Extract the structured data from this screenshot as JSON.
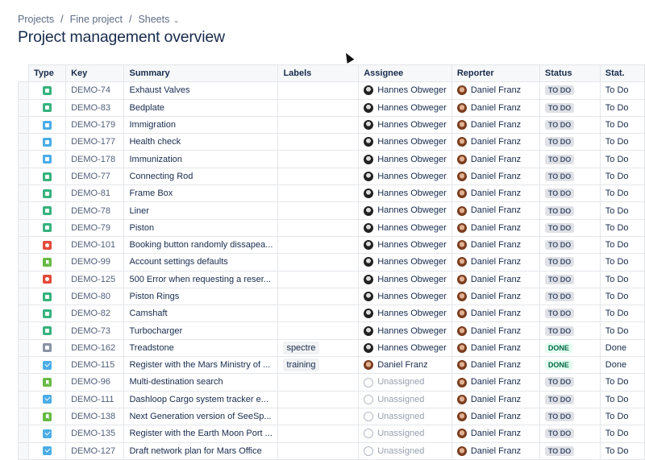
{
  "breadcrumbs": [
    "Projects",
    "Fine project",
    "Sheets"
  ],
  "title": "Project management overview",
  "columns": [
    "Type",
    "Key",
    "Summary",
    "Labels",
    "Assignee",
    "Reporter",
    "Status",
    "Stat."
  ],
  "type_colors": {
    "subtask": "#36b37e",
    "subtask-blue": "#4bade8",
    "bug": "#e5493a",
    "story": "#65ba43",
    "task": "#4bade8",
    "other": "#8993a4"
  },
  "rows": [
    {
      "type": "subtask",
      "key": "DEMO-74",
      "summary": "Exhaust Valves",
      "label": "",
      "assignee": "Hannes Obweger",
      "reporter": "Daniel Franz",
      "status": "TO DO",
      "status2": "To Do"
    },
    {
      "type": "subtask",
      "key": "DEMO-83",
      "summary": "Bedplate",
      "label": "",
      "assignee": "Hannes Obweger",
      "reporter": "Daniel Franz",
      "status": "TO DO",
      "status2": "To Do"
    },
    {
      "type": "subtask-blue",
      "key": "DEMO-179",
      "summary": "Immigration",
      "label": "",
      "assignee": "Hannes Obweger",
      "reporter": "Daniel Franz",
      "status": "TO DO",
      "status2": "To Do"
    },
    {
      "type": "subtask-blue",
      "key": "DEMO-177",
      "summary": "Health check",
      "label": "",
      "assignee": "Hannes Obweger",
      "reporter": "Daniel Franz",
      "status": "TO DO",
      "status2": "To Do"
    },
    {
      "type": "subtask-blue",
      "key": "DEMO-178",
      "summary": "Immunization",
      "label": "",
      "assignee": "Hannes Obweger",
      "reporter": "Daniel Franz",
      "status": "TO DO",
      "status2": "To Do"
    },
    {
      "type": "subtask",
      "key": "DEMO-77",
      "summary": "Connecting Rod",
      "label": "",
      "assignee": "Hannes Obweger",
      "reporter": "Daniel Franz",
      "status": "TO DO",
      "status2": "To Do"
    },
    {
      "type": "subtask",
      "key": "DEMO-81",
      "summary": "Frame Box",
      "label": "",
      "assignee": "Hannes Obweger",
      "reporter": "Daniel Franz",
      "status": "TO DO",
      "status2": "To Do"
    },
    {
      "type": "subtask",
      "key": "DEMO-78",
      "summary": "Liner",
      "label": "",
      "assignee": "Hannes Obweger",
      "reporter": "Daniel Franz",
      "status": "TO DO",
      "status2": "To Do"
    },
    {
      "type": "subtask",
      "key": "DEMO-79",
      "summary": "Piston",
      "label": "",
      "assignee": "Hannes Obweger",
      "reporter": "Daniel Franz",
      "status": "TO DO",
      "status2": "To Do"
    },
    {
      "type": "bug",
      "key": "DEMO-101",
      "summary": "Booking button randomly dissapea...",
      "label": "",
      "assignee": "Hannes Obweger",
      "reporter": "Daniel Franz",
      "status": "TO DO",
      "status2": "To Do"
    },
    {
      "type": "story",
      "key": "DEMO-99",
      "summary": "Account settings defaults",
      "label": "",
      "assignee": "Hannes Obweger",
      "reporter": "Daniel Franz",
      "status": "TO DO",
      "status2": "To Do"
    },
    {
      "type": "bug",
      "key": "DEMO-125",
      "summary": "500 Error when requesting a reser...",
      "label": "",
      "assignee": "Hannes Obweger",
      "reporter": "Daniel Franz",
      "status": "TO DO",
      "status2": "To Do"
    },
    {
      "type": "subtask",
      "key": "DEMO-80",
      "summary": "Piston Rings",
      "label": "",
      "assignee": "Hannes Obweger",
      "reporter": "Daniel Franz",
      "status": "TO DO",
      "status2": "To Do"
    },
    {
      "type": "subtask",
      "key": "DEMO-82",
      "summary": "Camshaft",
      "label": "",
      "assignee": "Hannes Obweger",
      "reporter": "Daniel Franz",
      "status": "TO DO",
      "status2": "To Do"
    },
    {
      "type": "subtask",
      "key": "DEMO-73",
      "summary": "Turbocharger",
      "label": "",
      "assignee": "Hannes Obweger",
      "reporter": "Daniel Franz",
      "status": "TO DO",
      "status2": "To Do"
    },
    {
      "type": "other",
      "key": "DEMO-162",
      "summary": "Treadstone",
      "label": "spectre",
      "assignee": "Hannes Obweger",
      "reporter": "Daniel Franz",
      "status": "DONE",
      "status2": "Done"
    },
    {
      "type": "task",
      "key": "DEMO-115",
      "summary": "Register with the Mars Ministry of ...",
      "label": "training",
      "assignee": "Daniel Franz",
      "reporter": "Daniel Franz",
      "status": "DONE",
      "status2": "Done"
    },
    {
      "type": "story",
      "key": "DEMO-96",
      "summary": "Multi-destination search",
      "label": "",
      "assignee": "Unassigned",
      "reporter": "Daniel Franz",
      "status": "TO DO",
      "status2": "To Do"
    },
    {
      "type": "task",
      "key": "DEMO-111",
      "summary": "Dashloop Cargo system tracker e...",
      "label": "",
      "assignee": "Unassigned",
      "reporter": "Daniel Franz",
      "status": "TO DO",
      "status2": "To Do"
    },
    {
      "type": "story",
      "key": "DEMO-138",
      "summary": "Next Generation version of SeeSp...",
      "label": "",
      "assignee": "Unassigned",
      "reporter": "Daniel Franz",
      "status": "TO DO",
      "status2": "To Do"
    },
    {
      "type": "task",
      "key": "DEMO-135",
      "summary": "Register with the Earth Moon Port ...",
      "label": "",
      "assignee": "Unassigned",
      "reporter": "Daniel Franz",
      "status": "TO DO",
      "status2": "To Do"
    },
    {
      "type": "task",
      "key": "DEMO-127",
      "summary": "Draft network plan for Mars Office",
      "label": "",
      "assignee": "Unassigned",
      "reporter": "Daniel Franz",
      "status": "TO DO",
      "status2": "To Do"
    }
  ]
}
